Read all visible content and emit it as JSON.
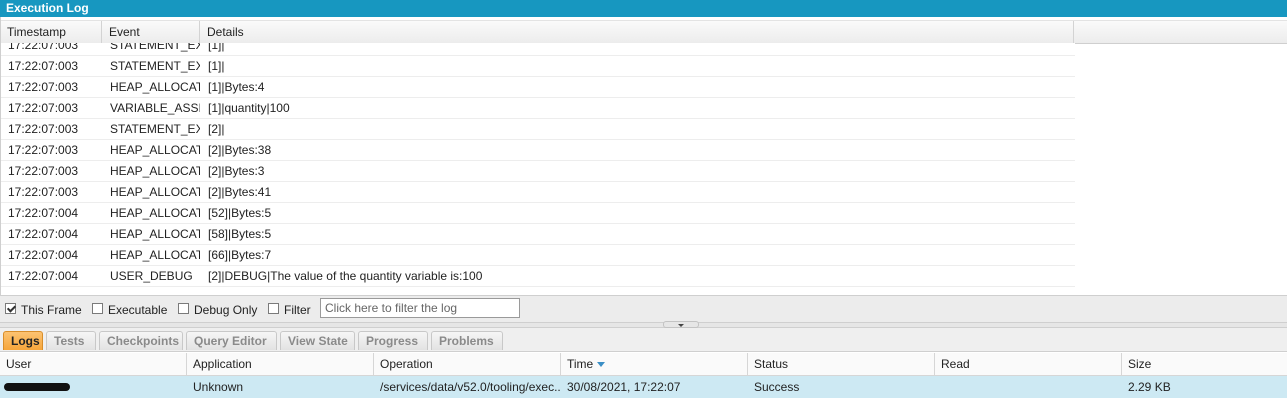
{
  "window": {
    "title": "Execution Log"
  },
  "log": {
    "columns": {
      "timestamp": "Timestamp",
      "event": "Event",
      "details": "Details"
    },
    "rows": [
      {
        "timestamp": "17:22:07:003",
        "event": "STATEMENT_EX...",
        "details": "[1]|"
      },
      {
        "timestamp": "17:22:07:003",
        "event": "STATEMENT_EX...",
        "details": "[1]|"
      },
      {
        "timestamp": "17:22:07:003",
        "event": "HEAP_ALLOCATE",
        "details": "[1]|Bytes:4"
      },
      {
        "timestamp": "17:22:07:003",
        "event": "VARIABLE_ASSI...",
        "details": "[1]|quantity|100"
      },
      {
        "timestamp": "17:22:07:003",
        "event": "STATEMENT_EX...",
        "details": "[2]|"
      },
      {
        "timestamp": "17:22:07:003",
        "event": "HEAP_ALLOCATE",
        "details": "[2]|Bytes:38"
      },
      {
        "timestamp": "17:22:07:003",
        "event": "HEAP_ALLOCATE",
        "details": "[2]|Bytes:3"
      },
      {
        "timestamp": "17:22:07:003",
        "event": "HEAP_ALLOCATE",
        "details": "[2]|Bytes:41"
      },
      {
        "timestamp": "17:22:07:004",
        "event": "HEAP_ALLOCATE",
        "details": "[52]|Bytes:5"
      },
      {
        "timestamp": "17:22:07:004",
        "event": "HEAP_ALLOCATE",
        "details": "[58]|Bytes:5"
      },
      {
        "timestamp": "17:22:07:004",
        "event": "HEAP_ALLOCATE",
        "details": "[66]|Bytes:7"
      },
      {
        "timestamp": "17:22:07:004",
        "event": "USER_DEBUG",
        "details": "[2]|DEBUG|The value of the quantity variable is:100"
      }
    ]
  },
  "filters": {
    "this_frame": {
      "label": "This Frame",
      "checked": true
    },
    "executable": {
      "label": "Executable",
      "checked": false
    },
    "debug_only": {
      "label": "Debug Only",
      "checked": false
    },
    "filter": {
      "label": "Filter",
      "checked": false
    },
    "filter_placeholder": "Click here to filter the log"
  },
  "tabs": [
    {
      "label": "Logs",
      "active": true
    },
    {
      "label": "Tests",
      "active": false
    },
    {
      "label": "Checkpoints",
      "active": false
    },
    {
      "label": "Query Editor",
      "active": false
    },
    {
      "label": "View State",
      "active": false
    },
    {
      "label": "Progress",
      "active": false
    },
    {
      "label": "Problems",
      "active": false
    }
  ],
  "logs_grid": {
    "columns": {
      "user": "User",
      "application": "Application",
      "operation": "Operation",
      "time": "Time",
      "status": "Status",
      "read": "Read",
      "size": "Size"
    },
    "sort": {
      "column": "time",
      "icon": "sort-desc-icon",
      "color": "#3b8fc6"
    },
    "rows": [
      {
        "user": "",
        "application": "Unknown",
        "operation": "/services/data/v52.0/tooling/exec...",
        "time": "30/08/2021, 17:22:07",
        "status": "Success",
        "read": "",
        "size": "2.29 KB"
      }
    ]
  },
  "colors": {
    "titlebar": "#1797c0",
    "active_tab": "#f6a53a",
    "selected_row": "#cde9f3"
  }
}
